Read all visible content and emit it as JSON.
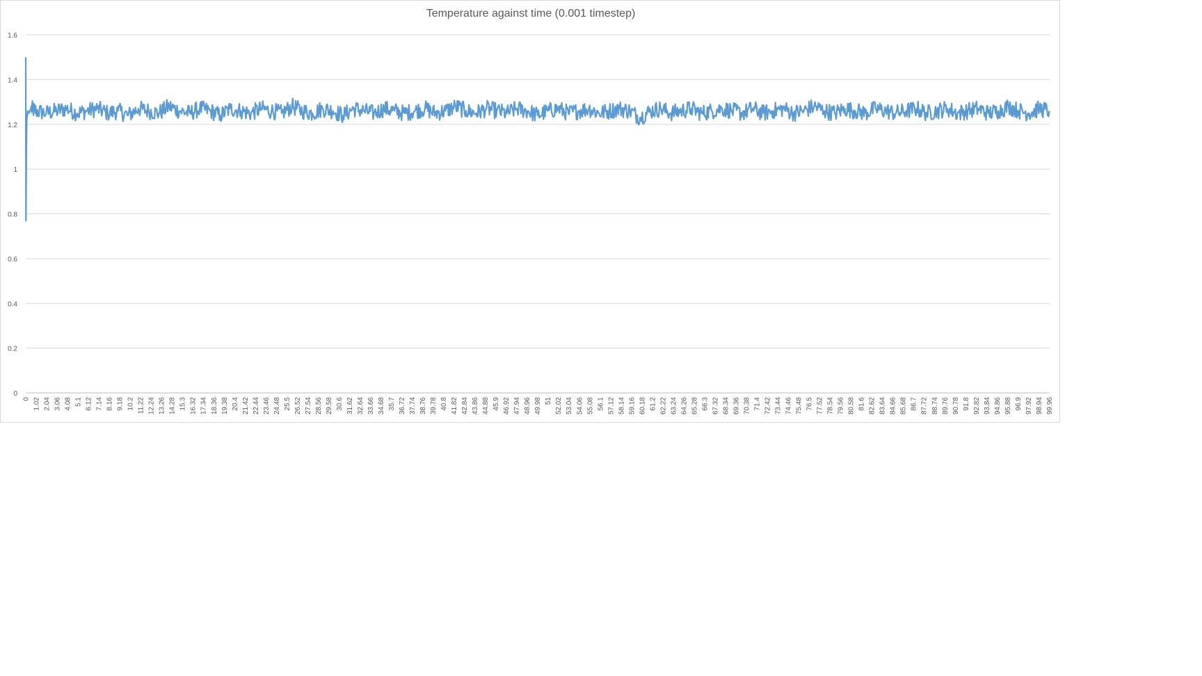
{
  "chart_data": {
    "type": "line",
    "title": "Temperature against time (0.001 timestep)",
    "xlabel": "",
    "ylabel": "",
    "ylim": [
      0,
      1.6
    ],
    "yticks": [
      "0",
      "0.2",
      "0.4",
      "0.6",
      "0.8",
      "1",
      "1.2",
      "1.4",
      "1.6"
    ],
    "xlim": [
      0,
      100
    ],
    "xticks": [
      "0",
      "1.02",
      "2.04",
      "3.06",
      "4.08",
      "5.1",
      "6.12",
      "7.14",
      "8.16",
      "9.18",
      "10.2",
      "11.22",
      "12.24",
      "13.26",
      "14.28",
      "15.3",
      "16.32",
      "17.34",
      "18.36",
      "19.38",
      "20.4",
      "21.42",
      "22.44",
      "23.46",
      "24.48",
      "25.5",
      "26.52",
      "27.54",
      "28.56",
      "29.58",
      "30.6",
      "31.62",
      "32.64",
      "33.66",
      "34.68",
      "35.7",
      "36.72",
      "37.74",
      "38.76",
      "39.78",
      "40.8",
      "41.82",
      "42.84",
      "43.86",
      "44.88",
      "45.9",
      "46.92",
      "47.94",
      "48.96",
      "49.98",
      "51",
      "52.02",
      "53.04",
      "54.06",
      "55.08",
      "56.1",
      "57.12",
      "58.14",
      "59.16",
      "60.18",
      "61.2",
      "62.22",
      "63.24",
      "64.26",
      "65.28",
      "66.3",
      "67.32",
      "68.34",
      "69.36",
      "70.38",
      "71.4",
      "72.42",
      "73.44",
      "74.46",
      "75.48",
      "76.5",
      "77.52",
      "78.54",
      "79.56",
      "80.58",
      "81.6",
      "82.62",
      "83.64",
      "84.66",
      "85.68",
      "86.7",
      "87.72",
      "88.74",
      "89.76",
      "90.78",
      "91.8",
      "92.82",
      "93.84",
      "94.86",
      "95.88",
      "96.9",
      "97.92",
      "98.94",
      "99.96"
    ],
    "grid": true,
    "legend": "none",
    "series": [
      {
        "name": "",
        "color": "#5b9bd5",
        "x": [
          0,
          0.02,
          0.06,
          0.1,
          0.2,
          0.3,
          0.5,
          1,
          2,
          3,
          4,
          5,
          6,
          7,
          8,
          9,
          10,
          11,
          12,
          13,
          14,
          15,
          16,
          17,
          18,
          19,
          20,
          21,
          22,
          23,
          24,
          25,
          26,
          27,
          28,
          29,
          30,
          31,
          32,
          33,
          34,
          35,
          36,
          37,
          38,
          39,
          40,
          41,
          42,
          43,
          44,
          45,
          46,
          47,
          48,
          49,
          50,
          51,
          52,
          53,
          54,
          55,
          56,
          57,
          58,
          59,
          60,
          61,
          62,
          63,
          64,
          65,
          66,
          67,
          68,
          69,
          70,
          71,
          72,
          73,
          74,
          75,
          76,
          77,
          78,
          79,
          80,
          81,
          82,
          83,
          84,
          85,
          86,
          87,
          88,
          89,
          90,
          91,
          92,
          93,
          94,
          95,
          96,
          97,
          98,
          99,
          99.96
        ],
        "y": [
          1.5,
          0.77,
          1.1,
          1.22,
          1.26,
          1.25,
          1.27,
          1.26,
          1.25,
          1.26,
          1.27,
          1.25,
          1.26,
          1.27,
          1.25,
          1.26,
          1.24,
          1.27,
          1.26,
          1.25,
          1.28,
          1.26,
          1.25,
          1.27,
          1.26,
          1.24,
          1.27,
          1.26,
          1.25,
          1.27,
          1.26,
          1.25,
          1.28,
          1.26,
          1.25,
          1.27,
          1.26,
          1.24,
          1.27,
          1.26,
          1.25,
          1.27,
          1.26,
          1.25,
          1.26,
          1.27,
          1.25,
          1.26,
          1.28,
          1.26,
          1.25,
          1.27,
          1.26,
          1.25,
          1.27,
          1.26,
          1.24,
          1.26,
          1.27,
          1.25,
          1.26,
          1.27,
          1.25,
          1.26,
          1.27,
          1.26,
          1.23,
          1.26,
          1.27,
          1.25,
          1.26,
          1.27,
          1.25,
          1.26,
          1.27,
          1.26,
          1.25,
          1.27,
          1.25,
          1.26,
          1.27,
          1.25,
          1.26,
          1.28,
          1.26,
          1.25,
          1.27,
          1.26,
          1.25,
          1.27,
          1.26,
          1.25,
          1.26,
          1.27,
          1.25,
          1.26,
          1.27,
          1.25,
          1.26,
          1.27,
          1.25,
          1.26,
          1.28,
          1.26,
          1.25,
          1.27,
          1.26
        ]
      }
    ]
  }
}
